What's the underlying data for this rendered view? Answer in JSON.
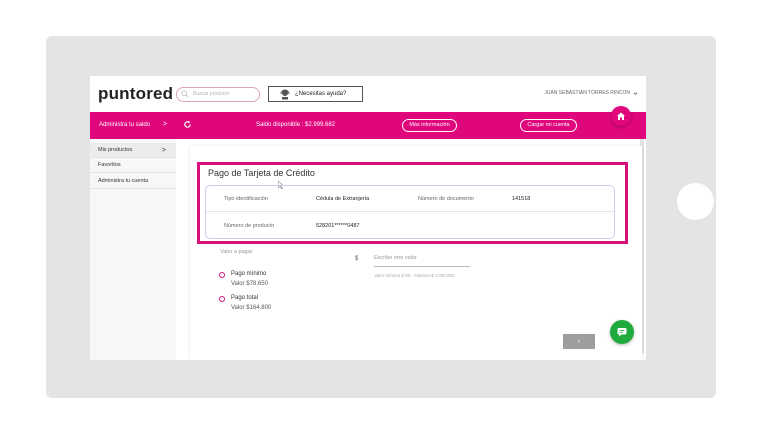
{
  "brand": {
    "logo": "puntored",
    "accent": "#e0077d",
    "chat_color": "#1faa3e"
  },
  "header": {
    "search_placeholder": "Buscar producto",
    "help_label": "¿Necesitas ayuda?",
    "user_name": "JUAN SEBASTIAN TORRES RINCON"
  },
  "pinkbar": {
    "admin_label": "Administra tu saldo",
    "admin_chevron": ">",
    "saldo_label": "Saldo disponible : $2.999.682",
    "info_button": "Más información",
    "cargar_button": "Cargar mi cuenta"
  },
  "sidebar": {
    "items": [
      {
        "label": "Mis productos",
        "chevron": ">"
      },
      {
        "label": "Favoritos"
      },
      {
        "label": "Administra tu cuenta"
      }
    ]
  },
  "card": {
    "title": "Pago de Tarjeta de Crédito",
    "rows": [
      {
        "label1": "Tipo identificación",
        "value1": "Cédula de Extranjería",
        "label2": "Número de documento",
        "value2": "141518"
      },
      {
        "label1": "Número de producto",
        "value1": "528201******0487"
      }
    ]
  },
  "payment": {
    "valor_label": "Valor a pagar",
    "currency": "$",
    "other_placeholder": "Escribe otro valor",
    "range_hint": "Valor mínimo $ 80 - máximo $ 1'000.000",
    "options": [
      {
        "label": "Pago mínimo",
        "value": "Valor $78.650"
      },
      {
        "label": "Pago total",
        "value": "Valor $164.800"
      }
    ]
  },
  "footer": {
    "back_label": "‹"
  },
  "icons": [
    "search-icon",
    "support-agent-icon",
    "chevron-down-icon",
    "refresh-icon",
    "home-icon",
    "chat-icon",
    "cursor-icon"
  ]
}
